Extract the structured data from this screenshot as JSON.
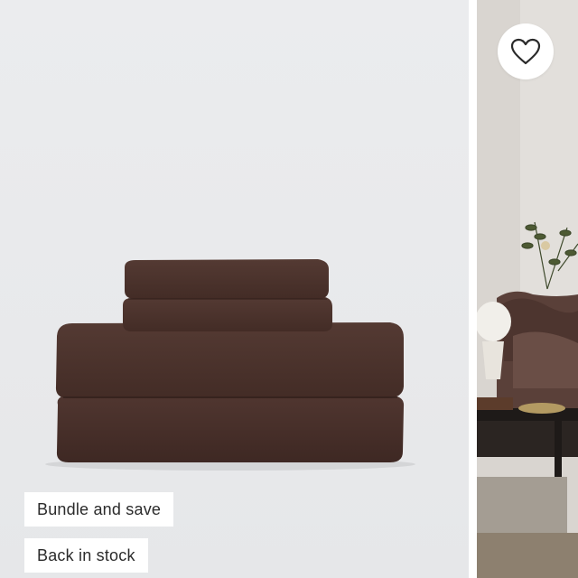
{
  "product_image": {
    "icon": "folded-sheet-set-image",
    "color": "#4a312b"
  },
  "lifestyle_image": {
    "icon": "bedroom-scene-image"
  },
  "badges": [
    {
      "label": "Bundle and save"
    },
    {
      "label": "Back in stock"
    }
  ],
  "wishlist": {
    "icon": "heart-icon"
  }
}
